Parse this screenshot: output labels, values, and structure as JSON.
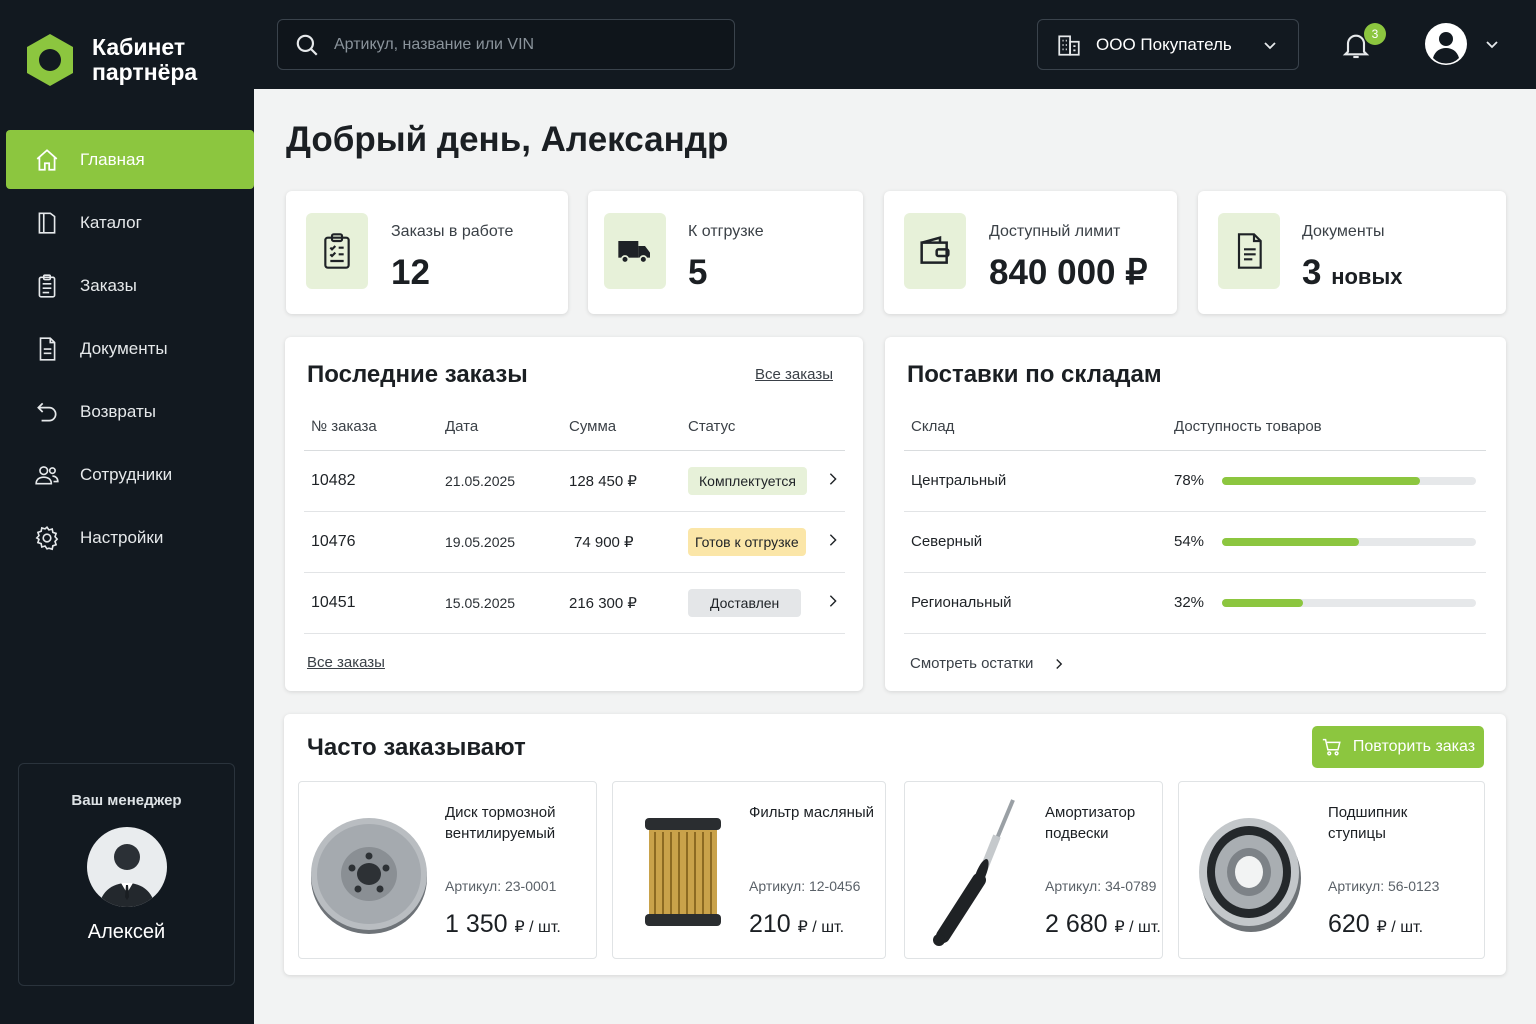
{
  "brand": {
    "title_line1": "Кабинет",
    "title_line2": "партнёра",
    "accent": "#8cc63f"
  },
  "sidebar": {
    "items": [
      {
        "label": "Главная",
        "icon": "home-icon",
        "active": true
      },
      {
        "label": "Каталог",
        "icon": "book-icon"
      },
      {
        "label": "Заказы",
        "icon": "clipboard-icon"
      },
      {
        "label": "Документы",
        "icon": "document-icon"
      },
      {
        "label": "Возвраты",
        "icon": "return-icon"
      },
      {
        "label": "Сотрудники",
        "icon": "users-icon"
      },
      {
        "label": "Настройки",
        "icon": "gear-icon"
      }
    ],
    "manager": {
      "title": "Ваш менеджер",
      "name": "Алексей"
    }
  },
  "header": {
    "search_placeholder": "Артикул, название или VIN",
    "company": "ООО Покупатель",
    "notifications": "3"
  },
  "greeting": "Добрый день, Александр",
  "stats": [
    {
      "label": "Заказы в работе",
      "value": "12",
      "icon": "clipboard-icon"
    },
    {
      "label": "К отгрузке",
      "value": "5",
      "icon": "truck-icon"
    },
    {
      "label": "Доступный лимит",
      "value": "840 000 ₽",
      "icon": "wallet-icon"
    },
    {
      "label": "Документы",
      "value": "3",
      "suffix": "новых",
      "icon": "document-icon"
    }
  ],
  "orders": {
    "title": "Последние заказы",
    "all_link": "Все заказы",
    "bottom_link": "Все заказы",
    "columns": [
      "№ заказа",
      "Дата",
      "Сумма",
      "Статус"
    ],
    "rows": [
      {
        "num": "10482",
        "date": "21.05.2025",
        "sum": "128 450 ₽",
        "status": "Комплектуется",
        "bg": "#e7f1d9"
      },
      {
        "num": "10476",
        "date": "19.05.2025",
        "sum": "74 900 ₽",
        "status": "Готов к отгрузке",
        "bg": "#fbe6a8"
      },
      {
        "num": "10451",
        "date": "15.05.2025",
        "sum": "216 300 ₽",
        "status": "Доставлен",
        "bg": "#e4e6e8"
      }
    ]
  },
  "warehouses": {
    "title": "Поставки по складам",
    "columns": [
      "Склад",
      "Доступность товаров"
    ],
    "rows": [
      {
        "name": "Центральный",
        "pct_label": "78%",
        "pct": 78
      },
      {
        "name": "Северный",
        "pct_label": "54%",
        "pct": 54
      },
      {
        "name": "Региональный",
        "pct_label": "32%",
        "pct": 32
      }
    ],
    "link": "Смотреть остатки"
  },
  "frequent": {
    "title": "Часто заказывают",
    "button": "Повторить заказ",
    "products": [
      {
        "name1": "Диск тормозной",
        "name2": "вентилируемый",
        "sku": "Артикул: 23-0001",
        "price": "1 350",
        "unit": "₽ / шт.",
        "icon": "brake-disc-image"
      },
      {
        "name1": "Фильтр масляный",
        "name2": "",
        "sku": "Артикул: 12-0456",
        "price": "210",
        "unit": "₽ / шт.",
        "icon": "oil-filter-image"
      },
      {
        "name1": "Амортизатор",
        "name2": "подвески",
        "sku": "Артикул: 34-0789",
        "price": "2 680",
        "unit": "₽ / шт.",
        "icon": "shock-absorber-image"
      },
      {
        "name1": "Подшипник",
        "name2": "ступицы",
        "sku": "Артикул: 56-0123",
        "price": "620",
        "unit": "₽ / шт.",
        "icon": "wheel-bearing-image"
      }
    ]
  }
}
